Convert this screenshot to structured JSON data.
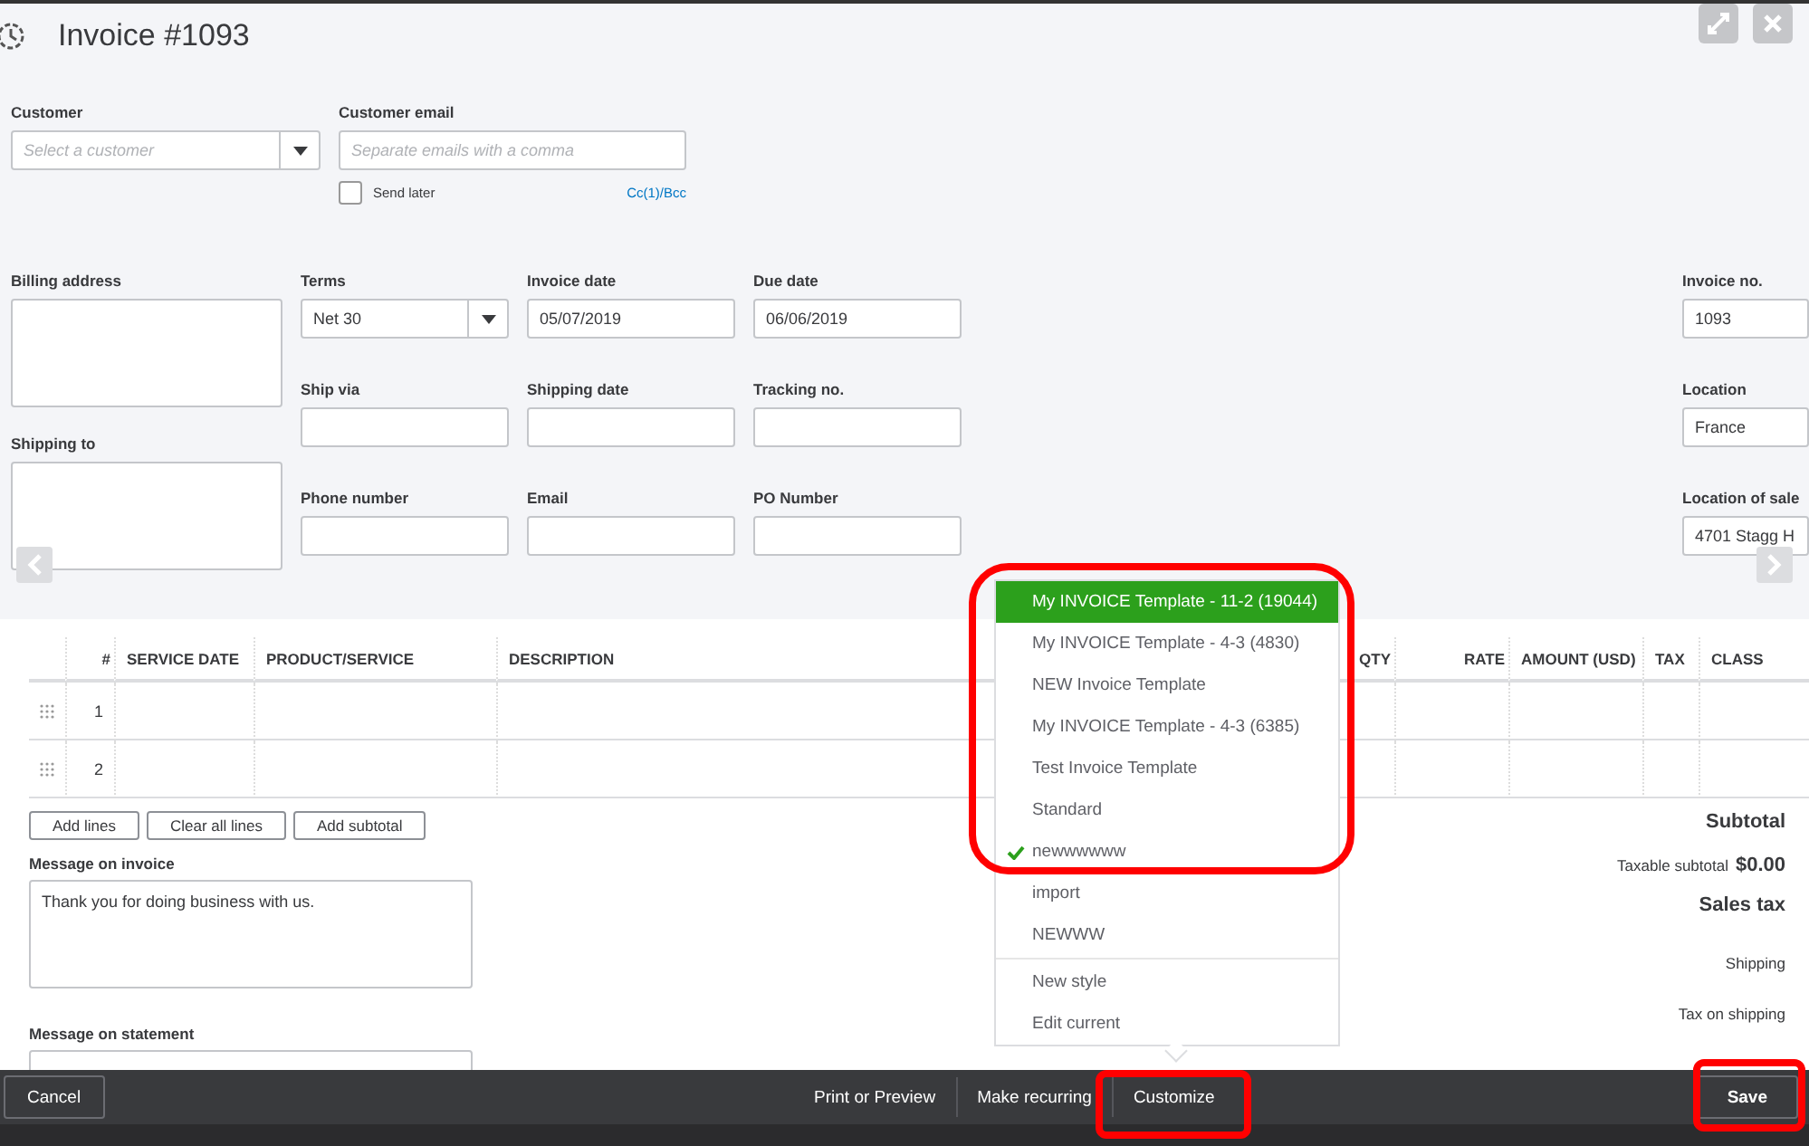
{
  "title": "Invoice #1093",
  "customer": {
    "label": "Customer",
    "placeholder": "Select a customer"
  },
  "customer_email": {
    "label": "Customer email",
    "placeholder": "Separate emails with a comma",
    "send_later": {
      "label": "Send later",
      "checked": false
    },
    "cc_link": "Cc(1)/Bcc"
  },
  "billing_address": {
    "label": "Billing address"
  },
  "shipping_to": {
    "label": "Shipping to"
  },
  "fields": [
    {
      "label": "Terms",
      "value": "Net 30",
      "kind": "select"
    },
    {
      "label": "Invoice date",
      "value": "05/07/2019",
      "kind": "text"
    },
    {
      "label": "Due date",
      "value": "06/06/2019",
      "kind": "text"
    },
    {
      "label": "Ship via",
      "kind": "text"
    },
    {
      "label": "Shipping date",
      "kind": "text"
    },
    {
      "label": "Tracking no.",
      "kind": "text"
    },
    {
      "label": "Phone number",
      "kind": "text"
    },
    {
      "label": "Email",
      "kind": "text"
    },
    {
      "label": "PO Number",
      "kind": "text"
    }
  ],
  "right_fields": [
    {
      "label": "Invoice no.",
      "value": "1093"
    },
    {
      "label": "Location",
      "value": "France"
    },
    {
      "label": "Location of sale",
      "value": "4701 Stagg H"
    }
  ],
  "table": {
    "columns": [
      {
        "label": "#"
      },
      {
        "label": "SERVICE DATE"
      },
      {
        "label": "PRODUCT/SERVICE"
      },
      {
        "label": "DESCRIPTION"
      },
      {
        "label": "QTY"
      },
      {
        "label": "RATE"
      },
      {
        "label": "AMOUNT (USD)"
      },
      {
        "label": "TAX"
      },
      {
        "label": "CLASS"
      }
    ],
    "rows": [
      {
        "number": "1"
      },
      {
        "number": "2"
      }
    ]
  },
  "line_buttons": [
    "Add lines",
    "Clear all lines",
    "Add subtotal"
  ],
  "message_on_invoice": {
    "label": "Message on invoice",
    "value": "Thank you for doing business with us."
  },
  "message_on_statement": {
    "label": "Message on statement"
  },
  "totals": [
    {
      "label": "Subtotal",
      "kind": "heading"
    },
    {
      "label": "Taxable subtotal",
      "value": "$0.00",
      "kind": "amount"
    },
    {
      "label": "Sales tax",
      "kind": "heading"
    },
    {
      "label": "Shipping",
      "kind": "line"
    },
    {
      "label": "Tax on shipping",
      "kind": "line"
    }
  ],
  "footer": {
    "cancel": "Cancel",
    "actions": [
      "Print or Preview",
      "Make recurring",
      "Customize"
    ],
    "save": "Save"
  },
  "template_menu": {
    "templates": [
      {
        "label": "My INVOICE Template - 11-2 (19044)",
        "selected": true,
        "checked": false
      },
      {
        "label": "My INVOICE Template - 4-3 (4830)",
        "selected": false,
        "checked": false
      },
      {
        "label": "NEW Invoice Template",
        "selected": false,
        "checked": false
      },
      {
        "label": "My INVOICE Template - 4-3 (6385)",
        "selected": false,
        "checked": false
      },
      {
        "label": "Test Invoice Template",
        "selected": false,
        "checked": false
      },
      {
        "label": "Standard",
        "selected": false,
        "checked": false
      },
      {
        "label": "newwwwww",
        "selected": false,
        "checked": true
      },
      {
        "label": "import",
        "selected": false,
        "checked": false
      },
      {
        "label": "NEWWW",
        "selected": false,
        "checked": false
      }
    ],
    "actions": [
      "New style",
      "Edit current"
    ]
  }
}
